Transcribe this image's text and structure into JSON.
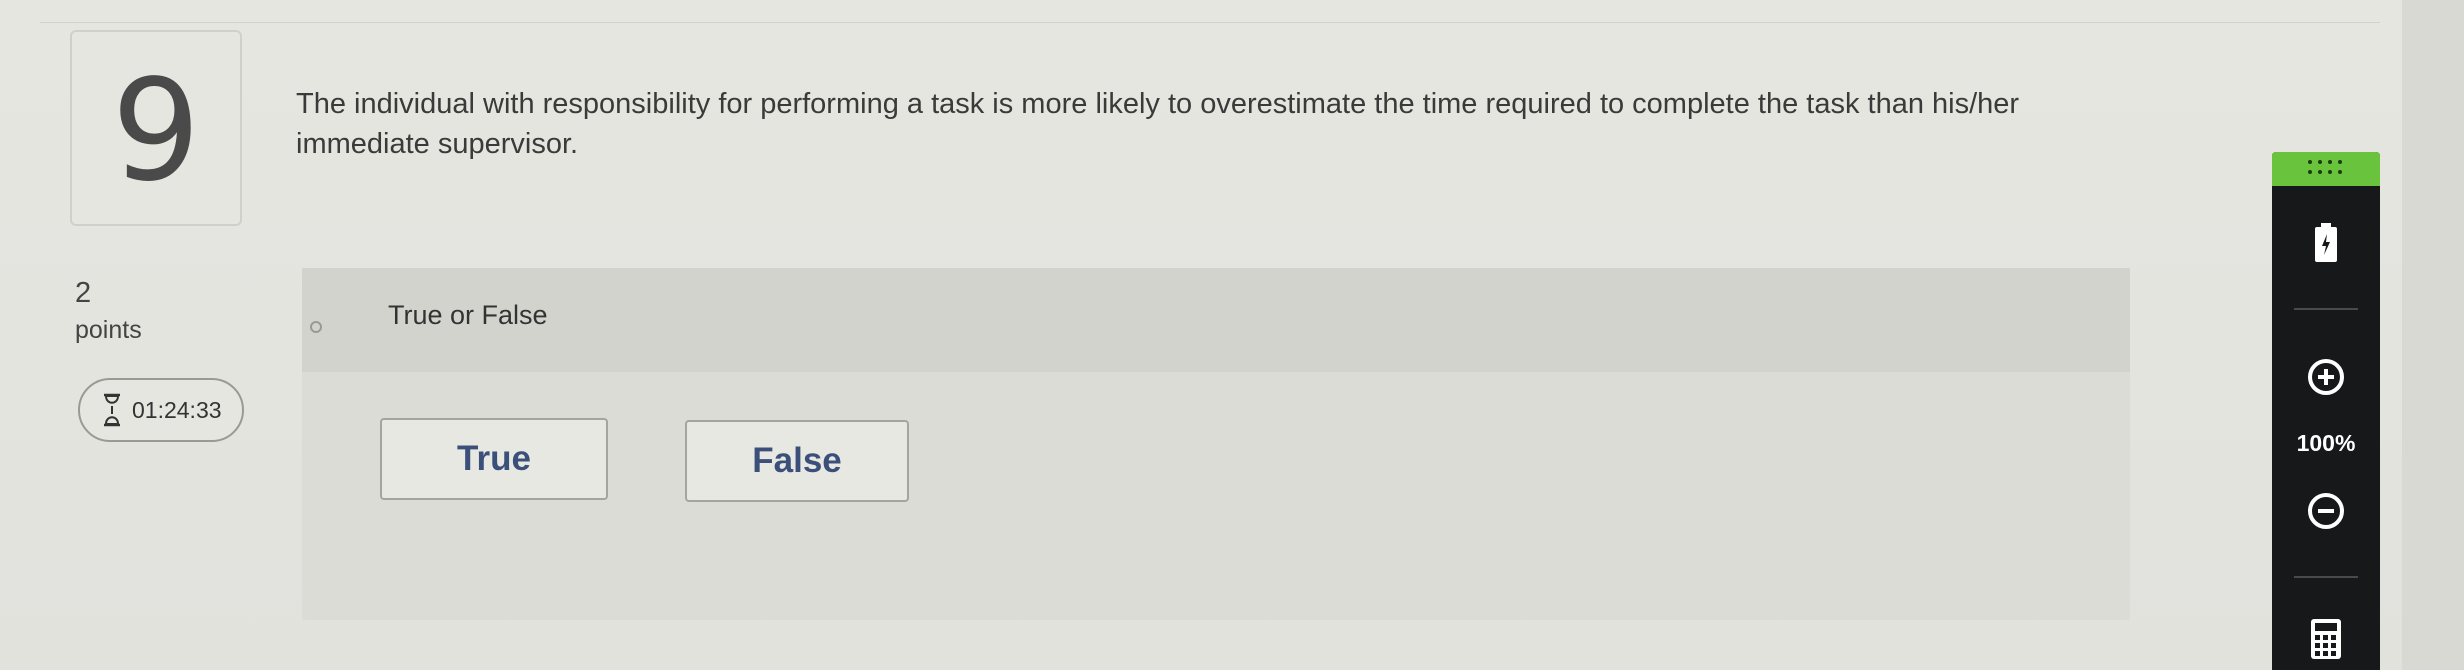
{
  "question": {
    "number": "9",
    "text": "The individual with responsibility for performing a task is more likely to overestimate the time required to complete the task than his/her immediate supervisor.",
    "points_value": "2",
    "points_label": "points",
    "timer": "01:24:33",
    "type_label": "True or False"
  },
  "answers": {
    "true_label": "True",
    "false_label": "False"
  },
  "toolbar": {
    "zoom_level": "100%",
    "icons": [
      "grip-icon",
      "battery-icon",
      "zoom-in-icon",
      "zoom-out-icon",
      "calculator-icon"
    ],
    "accent_color": "#6ac33c"
  }
}
